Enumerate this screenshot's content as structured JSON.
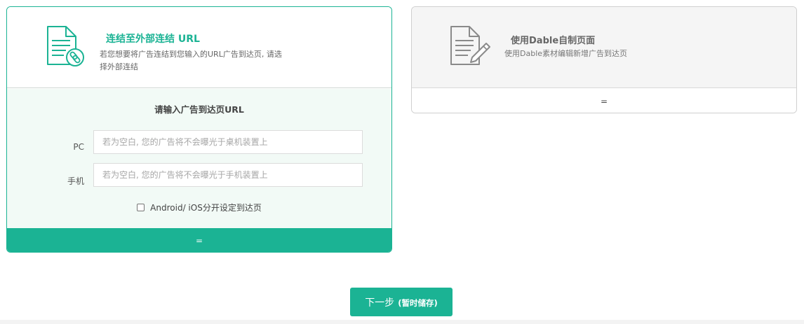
{
  "external_url_option": {
    "title": "连结至外部连结 URL",
    "description": "若您想要将广告连结到您输入的URL广告到达页, 请选择外部连结",
    "icon": "document-link-icon",
    "form_title": "请输入广告到达页URL",
    "pc_label": "PC",
    "pc_placeholder": "若为空白, 您的广告将不会曝光于桌机装置上",
    "mobile_label": "手机",
    "mobile_placeholder": "若为空白, 您的广告将不会曝光于手机装置上",
    "split_os_label": "Android/ iOS分开设定到达页",
    "split_os_checked": false,
    "collapse_handle": "=",
    "selected": true
  },
  "dable_page_option": {
    "title": "使用Dable自制页面",
    "description": "使用Dable素材编辑新增广告到达页",
    "icon": "document-edit-icon",
    "expand_handle": "=",
    "selected": false
  },
  "next_button": {
    "label": "下一步",
    "sublabel": "(暂时储存)"
  },
  "colors": {
    "accent": "#1bb394",
    "selected_body_bg": "#f2faf6",
    "unselected_head_bg": "#f5f5f5"
  }
}
